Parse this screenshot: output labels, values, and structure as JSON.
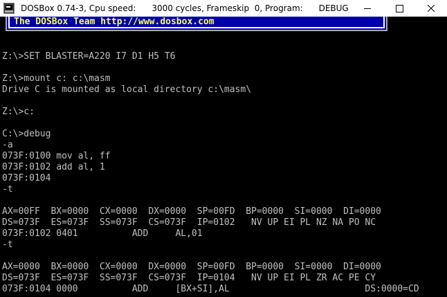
{
  "window": {
    "title_app": "DOSBox 0.74-3, Cpu speed:",
    "title_cycles": "3000 cycles, Frameskip  0, Program:",
    "title_program": "DEBUG"
  },
  "banner": {
    "text": "The DOSBox Team http://www.dosbox.com"
  },
  "console": {
    "lines": [
      "",
      "Z:\\>SET BLASTER=A220 I7 D1 H5 T6",
      "",
      "Z:\\>mount c: c:\\masm",
      "Drive C is mounted as local directory c:\\masm\\",
      "",
      "Z:\\>c:",
      "",
      "C:\\>debug",
      "-a",
      "073F:0100 mov al, ff",
      "073F:0102 add al, 1",
      "073F:0104",
      "-t",
      "",
      "AX=00FF  BX=0000  CX=0000  DX=0000  SP=00FD  BP=0000  SI=0000  DI=0000",
      "DS=073F  ES=073F  SS=073F  CS=073F  IP=0102   NV UP EI PL NZ NA PO NC",
      "073F:0102 0401          ADD     AL,01",
      "-t",
      "",
      "AX=0000  BX=0000  CX=0000  DX=0000  SP=00FD  BP=0000  SI=0000  DI=0000",
      "DS=073F  ES=073F  SS=073F  CS=073F  IP=0104   NV UP EI PL ZR AC PE CY",
      "073F:0104 0000          ADD     [BX+SI],AL                         DS:0000=CD"
    ],
    "prompt": "-",
    "typed": "▲"
  },
  "colors": {
    "console_bg": "#000000",
    "console_fg": "#c0c0c0",
    "banner_bg": "#0000aa",
    "banner_fg": "#ffff55",
    "titlebar_bg": "#ffffff"
  },
  "icons": {
    "app": "dosbox-app-icon",
    "minimize": "minimize-icon",
    "maximize": "maximize-icon",
    "close": "close-icon"
  }
}
